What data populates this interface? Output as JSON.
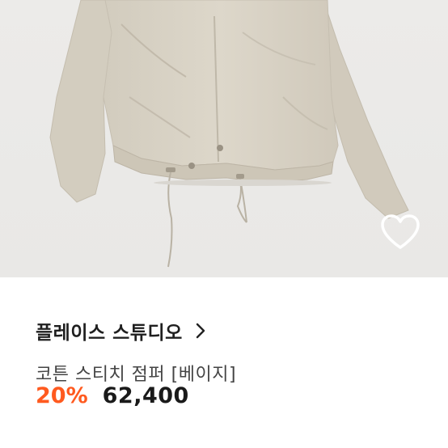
{
  "product": {
    "image_alt": "beige cotton stitch jumper",
    "brand": "플레이스 스튜디오",
    "name": "코튼 스티치 점퍼 [베이지]",
    "discount": "20%",
    "price": "62,400"
  },
  "icons": {
    "wishlist": "heart-outline-icon",
    "brand_link": "chevron-right-icon"
  },
  "colors": {
    "discount": "#ff5a1f",
    "image_background": "#ebe9e6",
    "garment": "#d9d3c6"
  }
}
